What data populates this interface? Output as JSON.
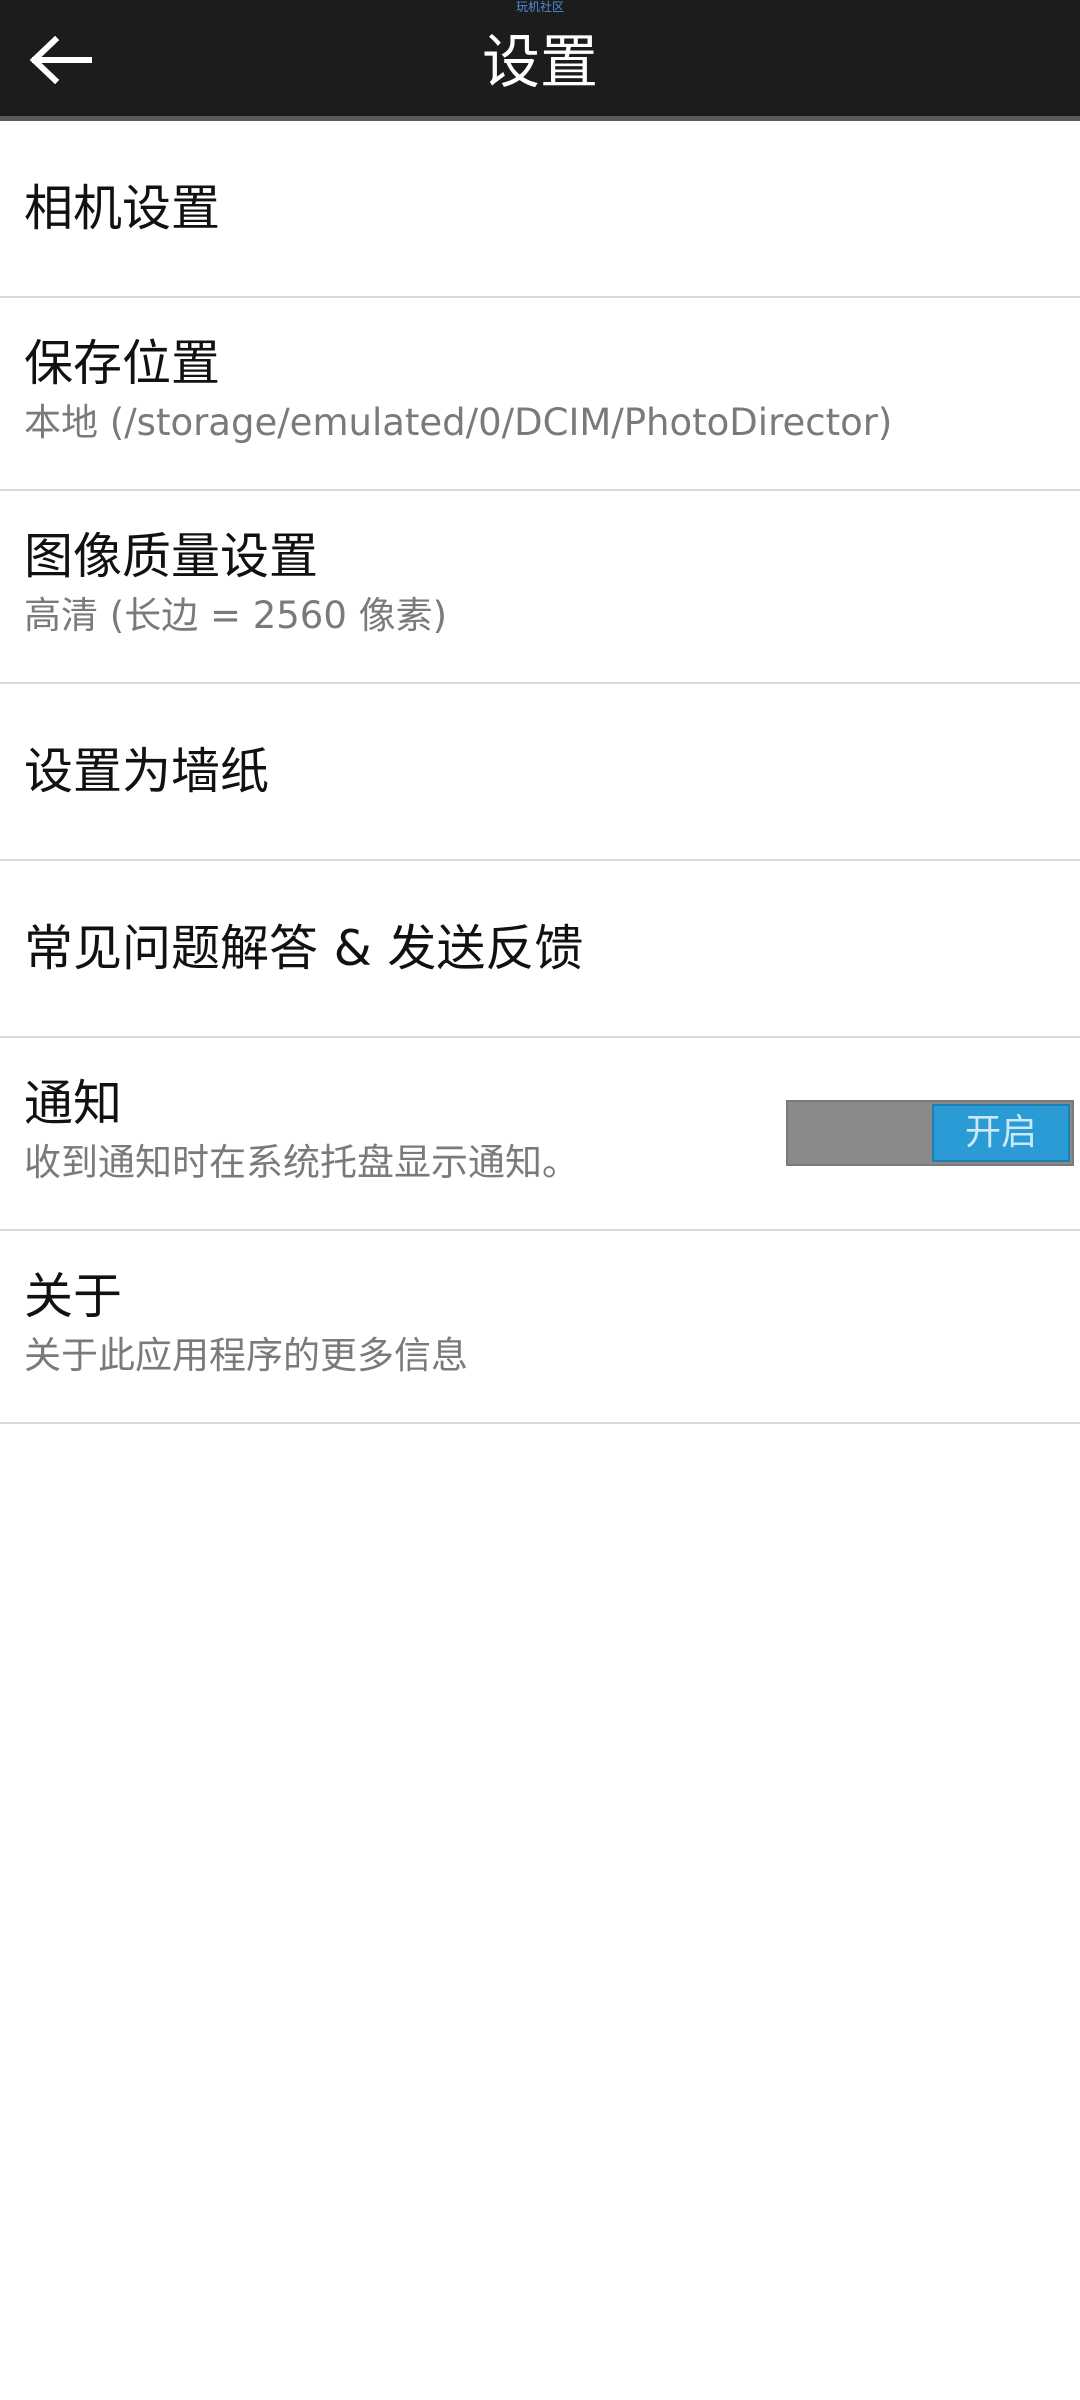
{
  "status_bar": {
    "text": "玩机社区"
  },
  "header": {
    "title": "设置",
    "back_icon": "arrow-left-icon"
  },
  "colors": {
    "header_bg": "#1c1c1c",
    "toggle_on": "#2b9bd6",
    "toggle_off_track": "#8a8a8a"
  },
  "items": [
    {
      "title": "相机设置"
    },
    {
      "title": "保存位置",
      "subtitle": "本地 (/storage/emulated/0/DCIM/PhotoDirector)"
    },
    {
      "title": "图像质量设置",
      "subtitle": "高清 (长边 = 2560 像素)"
    },
    {
      "title": "设置为墙纸"
    },
    {
      "title": "常见问题解答 & 发送反馈"
    },
    {
      "title": "通知",
      "subtitle": "收到通知时在系统托盘显示通知。",
      "toggle_label": "开启",
      "toggle_on": true
    },
    {
      "title": "关于",
      "subtitle": "关于此应用程序的更多信息"
    }
  ]
}
